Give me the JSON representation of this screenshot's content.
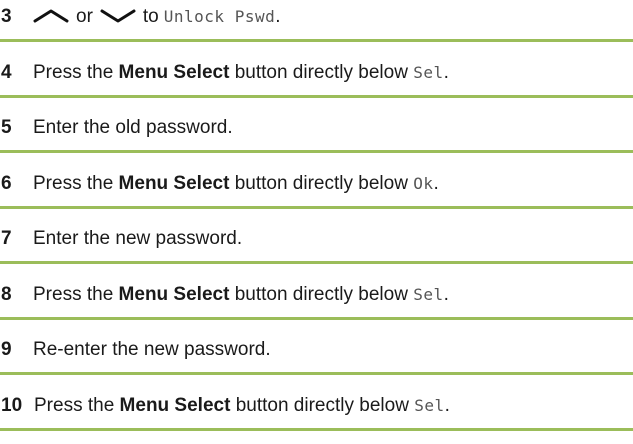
{
  "steps": [
    {
      "number": "3",
      "or_text": "or",
      "to_text": "to",
      "menu_item": "Unlock Pswd",
      "end": ".",
      "icons": [
        "chevron-up-icon",
        "chevron-down-icon"
      ]
    },
    {
      "number": "4",
      "pre": "Press the",
      "button_name": "Menu Select",
      "post": "button directly below",
      "softkey": "Sel",
      "end": "."
    },
    {
      "number": "5",
      "text": "Enter the old password."
    },
    {
      "number": "6",
      "pre": "Press the",
      "button_name": "Menu Select",
      "post": "button directly below",
      "softkey": "Ok",
      "end": "."
    },
    {
      "number": "7",
      "text": "Enter the new password."
    },
    {
      "number": "8",
      "pre": "Press the",
      "button_name": "Menu Select",
      "post": "button directly below",
      "softkey": "Sel",
      "end": "."
    },
    {
      "number": "9",
      "text": "Re-enter the new password."
    },
    {
      "number": "10",
      "pre": "Press the",
      "button_name": "Menu Select",
      "post": "button directly below",
      "softkey": "Sel",
      "end": "."
    }
  ],
  "colors": {
    "rule": "#9bbd5a",
    "text": "#1a1a1a",
    "display_text": "#555555"
  }
}
